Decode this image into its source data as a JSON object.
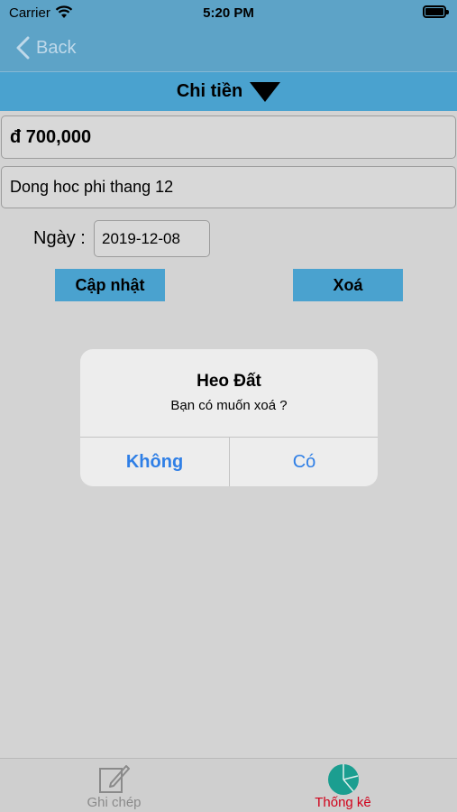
{
  "status_bar": {
    "carrier": "Carrier",
    "time": "5:20 PM"
  },
  "nav": {
    "back_label": "Back"
  },
  "header": {
    "title": "Chi tiền"
  },
  "form": {
    "amount": "đ 700,000",
    "note": "Dong hoc phi thang 12",
    "date_label": "Ngày :",
    "date_value": "2019-12-08",
    "update_button": "Cập nhật",
    "delete_button": "Xoá"
  },
  "alert": {
    "title": "Heo Đất",
    "message": "Bạn có muốn xoá ?",
    "cancel_button": "Không",
    "confirm_button": "Có",
    "button_color": "#2f7fe6"
  },
  "tabbar": {
    "tabs": [
      {
        "label": "Ghi chép",
        "icon": "edit-note-icon",
        "selected": false
      },
      {
        "label": "Thống kê",
        "icon": "pie-chart-icon",
        "selected": true
      }
    ]
  },
  "colors": {
    "nav_bar": "#5da3c7",
    "accent": "#4aa2cf",
    "selected_tab": "#d0021b",
    "chart_icon": "#1b9e90"
  }
}
